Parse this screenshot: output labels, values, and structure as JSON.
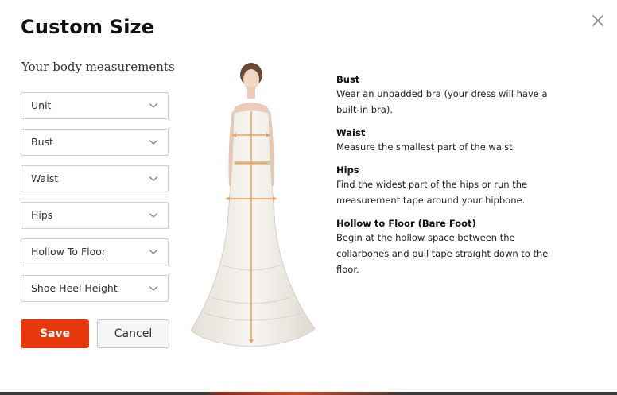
{
  "modal": {
    "title": "Custom Size",
    "close_icon": "close-icon"
  },
  "form": {
    "subtitle": "Your body measurements",
    "fields": [
      {
        "label": "Unit"
      },
      {
        "label": "Bust"
      },
      {
        "label": "Waist"
      },
      {
        "label": "Hips"
      },
      {
        "label": "Hollow To Floor"
      },
      {
        "label": "Shoe Heel Height"
      }
    ],
    "save_label": "Save",
    "cancel_label": "Cancel"
  },
  "guide": {
    "items": [
      {
        "title": "Bust",
        "text": "Wear an unpadded bra (your dress will have a built-in bra)."
      },
      {
        "title": "Waist",
        "text": "Measure the smallest part of the waist."
      },
      {
        "title": "Hips",
        "text": "Find the widest part of the hips or run the measurement tape around your hipbone."
      },
      {
        "title": "Hollow to Floor (Bare Foot)",
        "text": "Begin at the hollow space between the collarbones and pull tape straight down to the floor."
      }
    ]
  },
  "colors": {
    "accent": "#e8380d",
    "measure_line": "#f0a060"
  }
}
